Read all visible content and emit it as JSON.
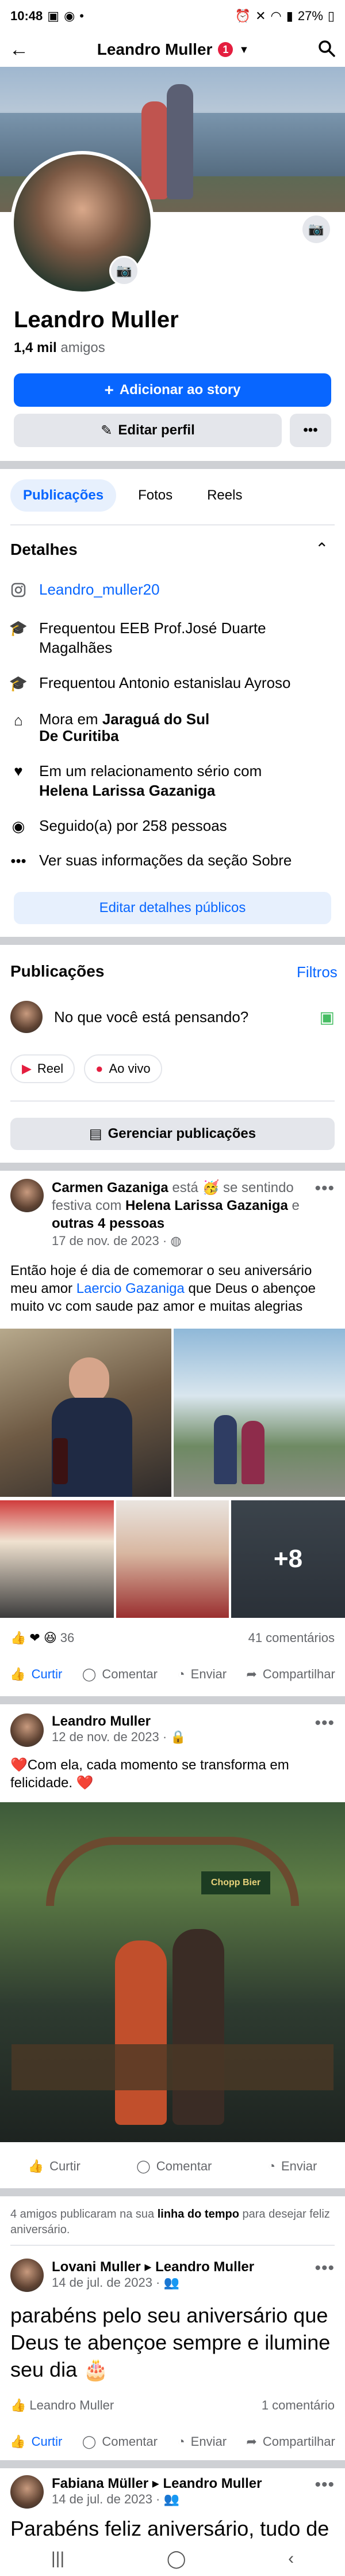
{
  "status_bar": {
    "time": "10:48",
    "battery": "27%"
  },
  "header": {
    "title": "Leandro Muller",
    "notification_count": "1"
  },
  "profile": {
    "name": "Leandro Muller",
    "friends_count": "1,4 mil",
    "friends_label": "amigos"
  },
  "buttons": {
    "add_story": "Adicionar ao story",
    "edit_profile": "Editar perfil",
    "more": "•••"
  },
  "tabs": [
    {
      "label": "Publicações"
    },
    {
      "label": "Fotos"
    },
    {
      "label": "Reels"
    }
  ],
  "details": {
    "title": "Detalhes",
    "instagram": "Leandro_muller20",
    "school1": "Frequentou EEB Prof.José Duarte Magalhães",
    "school2": "Frequentou Antonio estanislau Ayroso",
    "home_prefix": "Mora em",
    "home_city": "Jaraguá do Sul",
    "home_city2": "De Curitiba",
    "relationship_prefix": "Em um relacionamento sério com",
    "relationship_with": "Helena Larissa Gazaniga",
    "followed": "Seguido(a) por 258 pessoas",
    "about": "Ver suas informações da seção Sobre",
    "edit_public": "Editar detalhes públicos"
  },
  "publications": {
    "title": "Publicações",
    "filters": "Filtros",
    "composer_placeholder": "No que você está pensando?",
    "reel": "Reel",
    "live": "Ao vivo",
    "manage": "Gerenciar publicações"
  },
  "post1": {
    "author": "Carmen Gazaniga",
    "feeling_pre": "está",
    "feeling_text": "se sentindo festiva com",
    "with": "Helena Larissa Gazaniga",
    "and": "e",
    "others": "outras 4 pessoas",
    "date": "17 de nov. de 2023 ·",
    "text_a": "Então hoje é dia de comemorar o seu aniversário meu amor",
    "mention": "Laercio Gazaniga",
    "text_b": "que Deus o abençoe muito vc com saude paz amor e muitas alegrias",
    "more_photos": "+8",
    "reactions": "36",
    "comments": "41 comentários",
    "actions": {
      "like": "Curtir",
      "comment": "Comentar",
      "send": "Enviar",
      "share": "Compartilhar"
    }
  },
  "post2": {
    "author": "Leandro Muller",
    "date": "12 de nov. de 2023 ·",
    "text": "❤️Com ela, cada momento se transforma em felicidade. ❤️",
    "sign": "Chopp Bier",
    "actions": {
      "like": "Curtir",
      "comment": "Comentar",
      "send": "Enviar"
    }
  },
  "timeline_notice": {
    "pre": "4 amigos publicaram na sua",
    "bold": "linha do tempo",
    "post": "para desejar feliz aniversário."
  },
  "post3": {
    "author": "Lovani Muller",
    "target": "Leandro Muller",
    "date": "14 de jul. de 2023 ·",
    "text": "parabéns pelo seu aniversário que Deus te abençoe sempre e ilumine seu dia 🎂",
    "liker": "Leandro Muller",
    "comments": "1 comentário",
    "actions": {
      "like": "Curtir",
      "comment": "Comentar",
      "send": "Enviar",
      "share": "Compartilhar"
    }
  },
  "post4": {
    "author": "Fabiana Müller",
    "target": "Leandro Muller",
    "date": "14 de jul. de 2023 ·",
    "text": "Parabéns feliz aniversário, tudo de bom para vc"
  },
  "colors": {
    "accent": "#0866ff",
    "badge": "#e41e3f",
    "divider": "#ced0d4"
  }
}
